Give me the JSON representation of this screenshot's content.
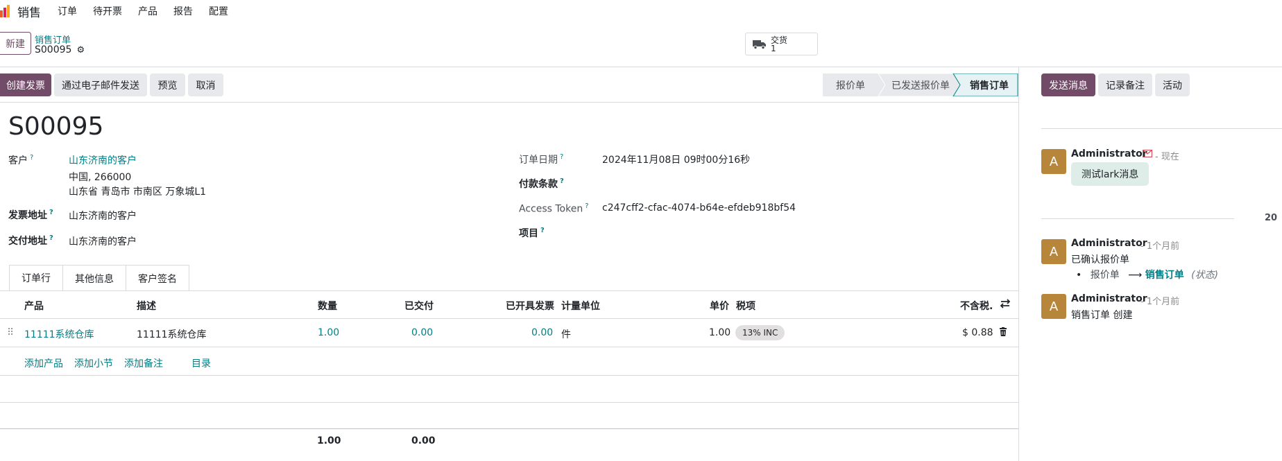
{
  "nav": {
    "app_name": "销售",
    "items": [
      "订单",
      "待开票",
      "产品",
      "报告",
      "配置"
    ]
  },
  "control": {
    "new_label": "新建",
    "breadcrumb": "销售订单",
    "record": "S00095",
    "smart_button": {
      "label": "交货",
      "count": "1"
    }
  },
  "actions": {
    "create_invoice": "创建发票",
    "send_email": "通过电子邮件发送",
    "preview": "预览",
    "cancel": "取消"
  },
  "stages": [
    "报价单",
    "已发送报价单",
    "销售订单"
  ],
  "chatter": {
    "send_message": "发送消息",
    "log_note": "记录备注",
    "activity": "活动",
    "date_sep": "20",
    "messages": [
      {
        "avatar": "A",
        "author": "Administrator",
        "meta": "- 现在",
        "body": "测试lark消息"
      },
      {
        "avatar": "A",
        "author": "Administrator",
        "meta": "- 1个月前",
        "body": "已确认报价单",
        "change_from": "报价单",
        "change_to": "销售订单",
        "change_field": "(状态)"
      },
      {
        "avatar": "A",
        "author": "Administrator",
        "meta": "- 1个月前",
        "body": "销售订单 创建"
      }
    ]
  },
  "form": {
    "title": "S00095",
    "customer_label": "客户",
    "customer_name": "山东济南的客户",
    "customer_addr1": "中国, 266000",
    "customer_addr2": "山东省 青岛市 市南区 万象城L1",
    "invoice_addr_label": "发票地址",
    "invoice_addr": "山东济南的客户",
    "delivery_addr_label": "交付地址",
    "delivery_addr": "山东济南的客户",
    "order_date_label": "订单日期",
    "order_date": "2024年11月08日 09时00分16秒",
    "payment_terms_label": "付款条款",
    "access_token_label": "Access Token",
    "access_token": "c247cff2-cfac-4074-b64e-efdeb918bf54",
    "project_label": "项目"
  },
  "tabs": [
    "订单行",
    "其他信息",
    "客户签名"
  ],
  "table": {
    "headers": {
      "product": "产品",
      "description": "描述",
      "quantity": "数量",
      "delivered": "已交付",
      "invoiced": "已开具发票",
      "uom": "计量单位",
      "unit_price": "单价",
      "taxes": "税项",
      "subtotal": "不含税."
    },
    "rows": [
      {
        "product": "11111系统仓库",
        "description": "11111系统仓库",
        "quantity": "1.00",
        "delivered": "0.00",
        "invoiced": "0.00",
        "uom": "件",
        "unit_price": "1.00",
        "tax": "13% INC",
        "subtotal": "$ 0.88"
      }
    ],
    "add_links": [
      "添加产品",
      "添加小节",
      "添加备注",
      "目录"
    ],
    "totals": {
      "quantity": "1.00",
      "delivered": "0.00"
    }
  },
  "colors": {
    "primary": "#714b67",
    "link": "#017e84",
    "avatar": "#b8863b"
  }
}
